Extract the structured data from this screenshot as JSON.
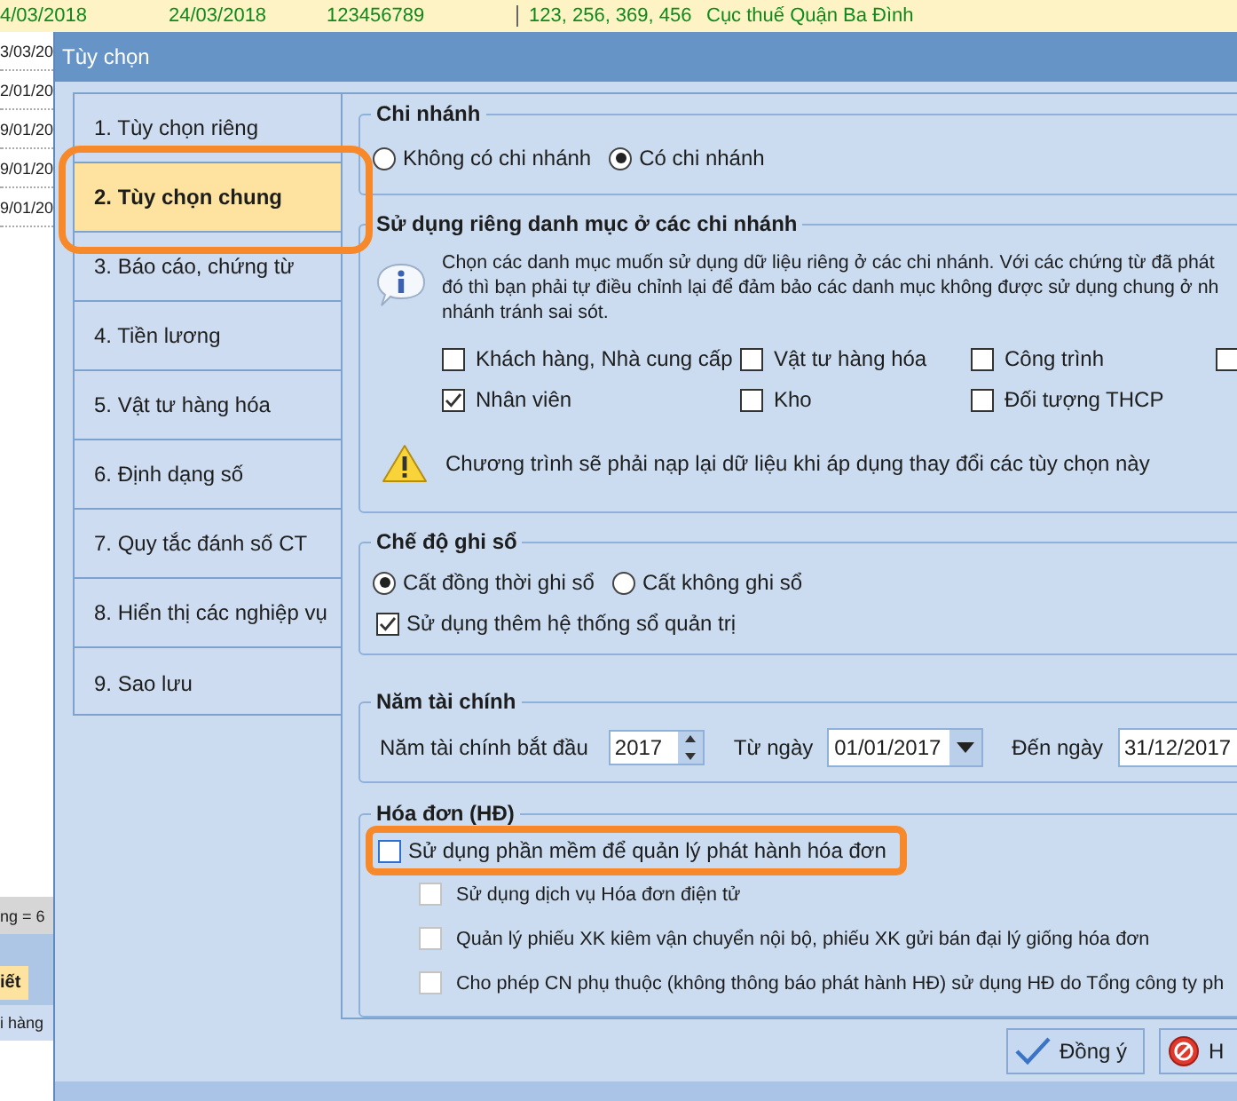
{
  "background": {
    "top_row": [
      "4/03/2018",
      "24/03/2018",
      "123456789",
      "123, 256, 369, 456",
      "Cục thuế Quận Ba Đình"
    ],
    "date_column": [
      "3/03/20",
      "2/01/20",
      "9/01/20",
      "9/01/20",
      "9/01/20"
    ],
    "status_text": "ng = 6",
    "tab": "iết",
    "cell": "i hàng"
  },
  "dialog": {
    "title": "Tùy chọn",
    "nav": [
      {
        "label": "1. Tùy chọn riêng",
        "selected": false
      },
      {
        "label": "2. Tùy chọn chung",
        "selected": true
      },
      {
        "label": "3. Báo cáo, chứng từ",
        "selected": false
      },
      {
        "label": "4. Tiền lương",
        "selected": false
      },
      {
        "label": "5. Vật tư hàng hóa",
        "selected": false
      },
      {
        "label": "6. Định dạng số",
        "selected": false
      },
      {
        "label": "7. Quy tắc đánh số CT",
        "selected": false
      },
      {
        "label": "8. Hiển thị các nghiệp vụ",
        "selected": false
      },
      {
        "label": "9. Sao lưu",
        "selected": false
      }
    ],
    "branch": {
      "title": "Chi nhánh",
      "options": [
        {
          "label": "Không có chi nhánh",
          "selected": false
        },
        {
          "label": "Có chi nhánh",
          "selected": true
        }
      ]
    },
    "branch_lists": {
      "title": "Sử dụng riêng danh mục ở các chi nhánh",
      "info_lines": [
        "Chọn các danh mục muốn sử dụng dữ liệu riêng ở các chi nhánh. Với các chứng từ đã phát",
        "đó thì bạn phải tự điều chỉnh lại để đảm bảo các danh mục không được sử dụng chung ở nh",
        "nhánh tránh sai sót."
      ],
      "items": [
        {
          "label": "Khách hàng, Nhà cung cấp",
          "checked": false
        },
        {
          "label": "Vật tư hàng hóa",
          "checked": false
        },
        {
          "label": "Công trình",
          "checked": false
        },
        {
          "checked": false
        },
        {
          "label": "Nhân viên",
          "checked": true
        },
        {
          "label": "Kho",
          "checked": false
        },
        {
          "label": "Đối tượng THCP",
          "checked": false
        }
      ],
      "warning": "Chương trình sẽ phải nạp lại dữ liệu khi áp dụng thay đổi các tùy chọn này"
    },
    "posting": {
      "title": "Chế độ ghi sổ",
      "options": [
        {
          "label": "Cất đồng thời ghi sổ",
          "selected": true
        },
        {
          "label": "Cất không ghi sổ",
          "selected": false
        }
      ],
      "management": {
        "label": "Sử dụng thêm hệ thống sổ quản trị",
        "checked": true
      }
    },
    "fiscal": {
      "title": "Năm tài chính",
      "start_label": "Năm tài chính bắt đầu",
      "start_year": "2017",
      "from_label": "Từ ngày",
      "from_date": "01/01/2017",
      "to_label": "Đến ngày",
      "to_date": "31/12/2017"
    },
    "invoice": {
      "title": "Hóa đơn (HĐ)",
      "main": {
        "label": "Sử dụng phần mềm để quản lý phát hành hóa đơn",
        "checked": false
      },
      "subs": [
        {
          "label": "Sử dụng dịch vụ Hóa đơn điện tử",
          "checked": false,
          "disabled": true
        },
        {
          "label": "Quản lý phiếu XK kiêm vận chuyển nội bộ, phiếu XK gửi bán đại lý giống hóa đơn",
          "checked": false,
          "disabled": true
        },
        {
          "label": "Cho phép CN phụ thuộc (không thông báo phát hành HĐ) sử dụng HĐ do Tổng công ty ph",
          "checked": false,
          "disabled": true
        }
      ]
    },
    "buttons": [
      {
        "label": "Đồng ý",
        "kind": "ok"
      },
      {
        "label": "H",
        "kind": "cancel"
      }
    ]
  }
}
